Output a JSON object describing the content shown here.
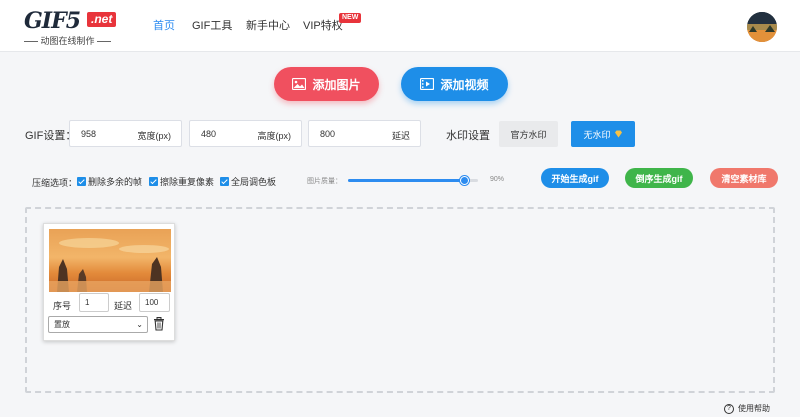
{
  "header": {
    "logo_text": "GIF5",
    "logo_badge": ".net",
    "logo_sub": "动图在线制作",
    "nav": [
      {
        "label": "首页",
        "active": true
      },
      {
        "label": "GIF工具",
        "active": false
      },
      {
        "label": "新手中心",
        "active": false
      },
      {
        "label": "VIP特权",
        "active": false
      }
    ],
    "new_badge": "NEW"
  },
  "actions": {
    "add_image": "添加图片",
    "add_video": "添加视频"
  },
  "gif_settings": {
    "label": "GIF设置：",
    "width_value": "958",
    "width_unit": "宽度(px)",
    "height_value": "480",
    "height_unit": "高度(px)",
    "delay_value": "800",
    "delay_unit": "延迟"
  },
  "watermark": {
    "label": "水印设置",
    "official": "官方水印",
    "none": "无水印"
  },
  "compression": {
    "label": "压缩选项：",
    "options": [
      {
        "label": "删除多余的帧",
        "checked": true
      },
      {
        "label": "擦除重复像素",
        "checked": true
      },
      {
        "label": "全局调色板",
        "checked": true
      }
    ],
    "quality_label": "图片质量：",
    "quality_value": "90%",
    "quality_fraction": 0.9
  },
  "buttons": {
    "start": "开始生成gif",
    "reverse": "倒序生成gif",
    "clear": "清空素材库"
  },
  "frame_card": {
    "index_label": "序号",
    "index_value": "1",
    "delay_label": "延迟",
    "delay_value": "100",
    "mode_value": "置放"
  },
  "help": "使用帮助",
  "colors": {
    "accent_blue": "#1e8ee8",
    "accent_red": "#f0505f",
    "accent_green": "#3fb54a"
  }
}
